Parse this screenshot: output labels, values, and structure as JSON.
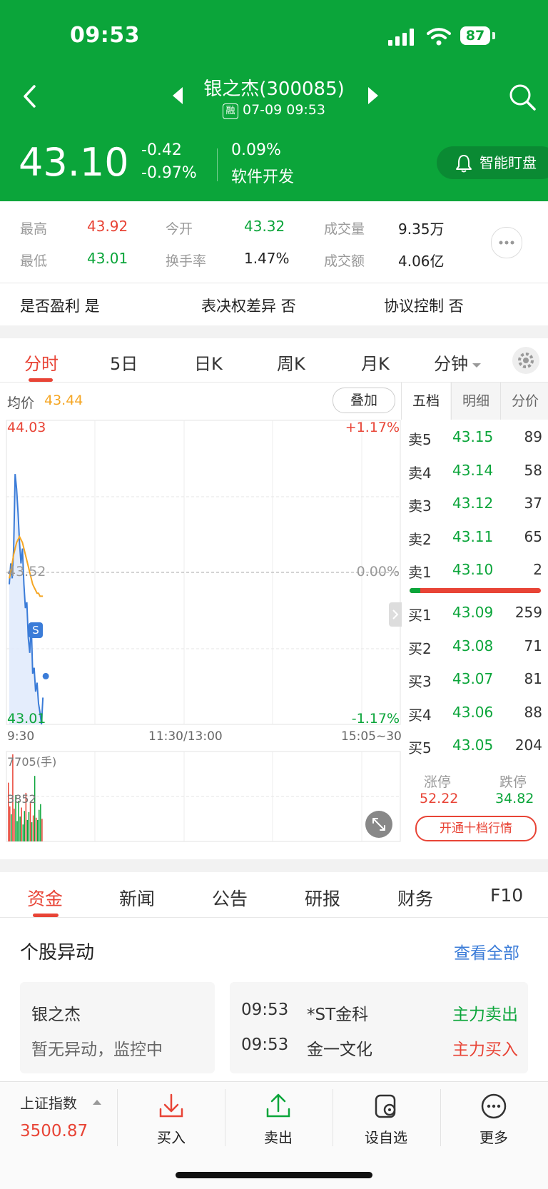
{
  "status_bar": {
    "time": "09:53",
    "battery": "87"
  },
  "header": {
    "title": "银之杰(300085)",
    "subtitle": "07-09 09:53",
    "rong_badge": "融",
    "price": "43.10",
    "change": "-0.42",
    "change_pct": "-0.97%",
    "turnover_pct": "0.09%",
    "sector": "软件开发",
    "watch_label": "智能盯盘"
  },
  "stats": {
    "high_label": "最高",
    "high": "43.92",
    "open_label": "今开",
    "open": "43.32",
    "volume_label": "成交量",
    "volume": "9.35万",
    "low_label": "最低",
    "low": "43.01",
    "turnover_label": "换手率",
    "turnover": "1.47%",
    "amount_label": "成交额",
    "amount": "4.06亿"
  },
  "info": {
    "profit": "是否盈利 是",
    "voting": "表决权差异 否",
    "agreement": "协议控制 否"
  },
  "chart_tabs": [
    "分时",
    "5日",
    "日K",
    "周K",
    "月K",
    "分钟"
  ],
  "chart": {
    "avg_label": "均价",
    "avg_value": "43.44",
    "overlay_btn": "叠加",
    "y_top": "44.03",
    "y_mid": "43.52",
    "y_bot": "43.01",
    "pct_top": "+1.17%",
    "pct_mid": "0.00%",
    "pct_bot": "-1.17%",
    "x_start": "9:30",
    "x_mid": "11:30/13:00",
    "x_end": "15:05~30",
    "vol_top": "7705(手)",
    "vol_mid": "3852",
    "s_marker": "S"
  },
  "chart_data": {
    "type": "line",
    "x": [
      "9:30",
      "9:31",
      "9:32",
      "9:33",
      "9:34",
      "9:35",
      "9:36",
      "9:37",
      "9:38",
      "9:39",
      "9:40",
      "9:41",
      "9:42",
      "9:43",
      "9:44",
      "9:45",
      "9:46",
      "9:47",
      "9:48",
      "9:49",
      "9:50",
      "9:51",
      "9:52",
      "9:53"
    ],
    "series": [
      {
        "name": "价格",
        "values": [
          43.48,
          43.55,
          43.5,
          43.6,
          43.85,
          43.8,
          43.72,
          43.62,
          43.55,
          43.6,
          43.48,
          43.4,
          43.42,
          43.3,
          43.25,
          43.35,
          43.18,
          43.2,
          43.12,
          43.15,
          43.08,
          43.05,
          43.01,
          43.1
        ]
      },
      {
        "name": "均价",
        "values": [
          43.5,
          43.52,
          43.55,
          43.58,
          43.6,
          43.62,
          43.63,
          43.64,
          43.63,
          43.62,
          43.6,
          43.58,
          43.56,
          43.54,
          43.52,
          43.5,
          43.48,
          43.47,
          43.46,
          43.45,
          43.45,
          43.44,
          43.44,
          43.44
        ]
      }
    ],
    "volume": [
      5200,
      3100,
      2400,
      7705,
      2900,
      4100,
      1800,
      3600,
      2200,
      3000,
      1500,
      2700,
      4300,
      1900,
      2600,
      3400,
      1700,
      2300,
      5800,
      2100,
      1900,
      2800,
      3300,
      2000
    ],
    "ylim": [
      43.01,
      44.03
    ],
    "prev_close": 43.52,
    "vol_max": 7705
  },
  "orderbook": {
    "tabs": [
      "五档",
      "明细",
      "分价"
    ],
    "asks": [
      {
        "label": "卖5",
        "price": "43.15",
        "vol": "89"
      },
      {
        "label": "卖4",
        "price": "43.14",
        "vol": "58"
      },
      {
        "label": "卖3",
        "price": "43.12",
        "vol": "37"
      },
      {
        "label": "卖2",
        "price": "43.11",
        "vol": "65"
      },
      {
        "label": "卖1",
        "price": "43.10",
        "vol": "2"
      }
    ],
    "bids": [
      {
        "label": "买1",
        "price": "43.09",
        "vol": "259"
      },
      {
        "label": "买2",
        "price": "43.08",
        "vol": "71"
      },
      {
        "label": "买3",
        "price": "43.07",
        "vol": "81"
      },
      {
        "label": "买4",
        "price": "43.06",
        "vol": "88"
      },
      {
        "label": "买5",
        "price": "43.05",
        "vol": "204"
      }
    ],
    "limit_up_label": "涨停",
    "limit_up": "52.22",
    "limit_down_label": "跌停",
    "limit_down": "34.82",
    "ten_level_btn": "开通十档行情"
  },
  "news_tabs": [
    "资金",
    "新闻",
    "公告",
    "研报",
    "财务",
    "F10"
  ],
  "movement": {
    "title": "个股异动",
    "view_all": "查看全部",
    "stock_name": "银之杰",
    "stock_status": "暂无异动，监控中",
    "items": [
      {
        "time": "09:53",
        "name": "*ST金科",
        "action": "主力卖出"
      },
      {
        "time": "09:53",
        "name": "金一文化",
        "action": "主力买入"
      }
    ]
  },
  "bottom": {
    "index_name": "上证指数",
    "index_value": "3500.87",
    "buy": "买入",
    "sell": "卖出",
    "watchlist": "设自选",
    "more": "更多"
  },
  "colors": {
    "brand_green": "#0BA53A",
    "red": "#E84436",
    "blue_line": "#3B7CD8",
    "avg_line": "#F5A623"
  }
}
